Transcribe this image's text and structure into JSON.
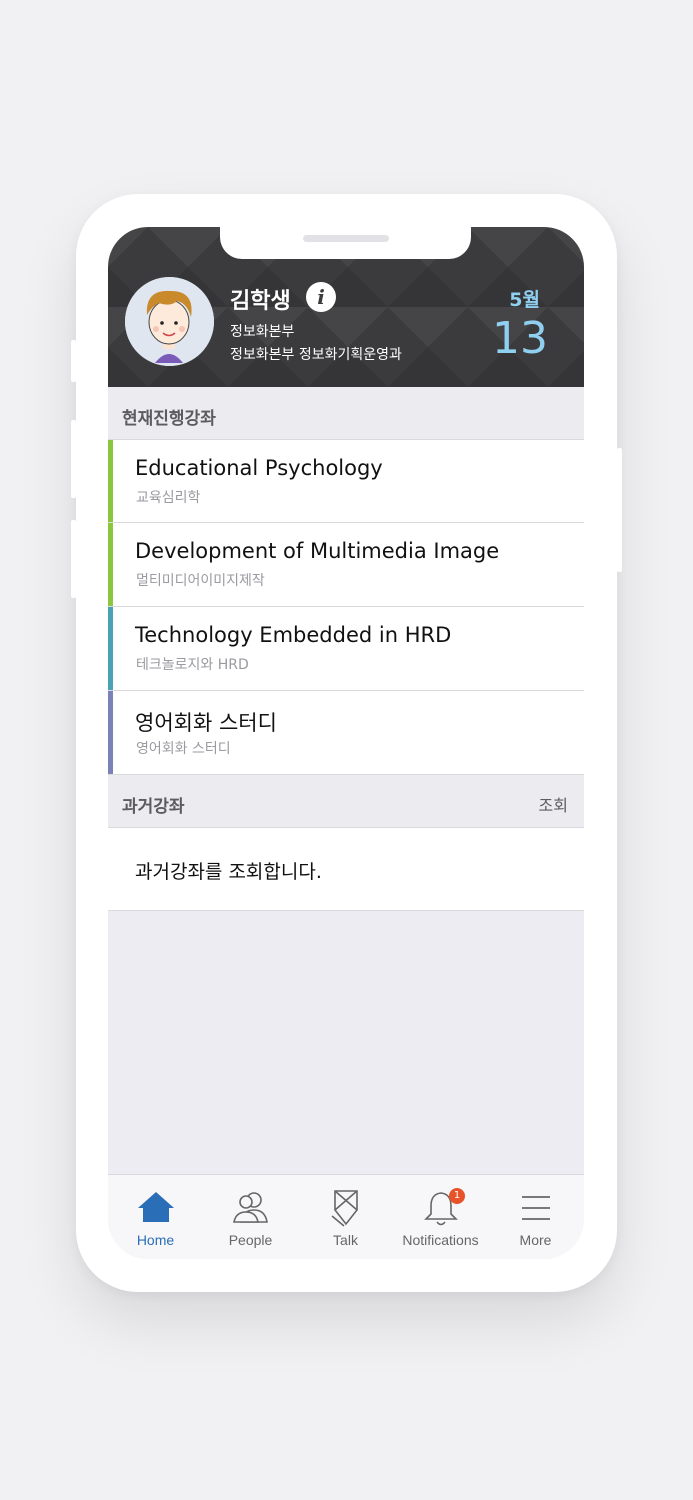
{
  "colors": {
    "accent": "#2a6eb8",
    "date": "#8fd0f0",
    "course_bars": [
      "#8cc63f",
      "#8cc63f",
      "#4aa3b5",
      "#7b82b8"
    ],
    "badge": "#e8542a"
  },
  "profile": {
    "name": "김학생",
    "dept_line1": "정보화본부",
    "dept_line2": "정보화본부 정보화기획운영과",
    "month": "5월",
    "day": "13"
  },
  "current_courses": {
    "title": "현재진행강좌",
    "items": [
      {
        "title": "Educational Psychology",
        "subtitle": "교육심리학"
      },
      {
        "title": "Development of Multimedia Image",
        "subtitle": "멀티미디어이미지제작"
      },
      {
        "title": "Technology Embedded in HRD",
        "subtitle": "테크놀로지와 HRD"
      },
      {
        "title": "영어회화 스터디",
        "subtitle": "영어회화 스터디"
      }
    ]
  },
  "past_courses": {
    "title": "과거강좌",
    "action": "조회",
    "message": "과거강좌를 조회합니다."
  },
  "tabbar": {
    "items": [
      {
        "label": "Home",
        "icon": "home-icon"
      },
      {
        "label": "People",
        "icon": "people-icon"
      },
      {
        "label": "Talk",
        "icon": "talk-icon"
      },
      {
        "label": "Notifications",
        "icon": "bell-icon",
        "badge": "1"
      },
      {
        "label": "More",
        "icon": "menu-icon"
      }
    ]
  }
}
